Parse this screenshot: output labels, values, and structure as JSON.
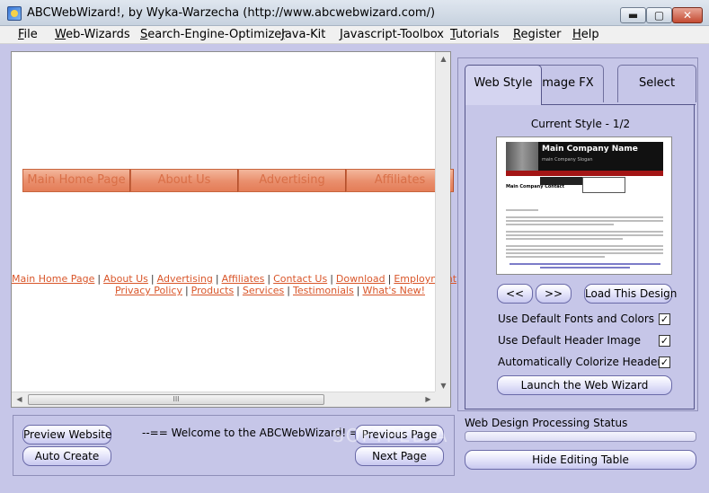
{
  "window": {
    "title": "ABCWebWizard!, by Wyka-Warzecha (http://www.abcwebwizard.com/)",
    "min_glyph": "▬",
    "max_glyph": "▢",
    "close_glyph": "✕"
  },
  "menu": [
    "File",
    "Web-Wizards",
    "Search-Engine-Optimizer",
    "Java-Kit",
    "Javascript-Toolbox",
    "Tutorials",
    "Register",
    "Help"
  ],
  "preview": {
    "nav_buttons": [
      "Main Home Page",
      "About Us",
      "Advertising",
      "Affiliates"
    ],
    "links_row1": [
      "Main Home Page",
      "About Us",
      "Advertising",
      "Affiliates",
      "Contact Us",
      "Download",
      "Employment"
    ],
    "links_row2": [
      "Privacy Policy",
      "Products",
      "Services",
      "Testimonials",
      "What's New!"
    ],
    "separator": "|",
    "scroll_up": "▲",
    "scroll_down": "▼",
    "scroll_left": "◀",
    "scroll_right": "▶",
    "hthumb_grip": "III"
  },
  "bottom_panel": {
    "preview_website": "Preview Website",
    "auto_create": "Auto Create",
    "welcome": "--== Welcome to the ABCWebWizard! ==--",
    "previous_page": "Previous Page",
    "next_page": "Next Page"
  },
  "tabs": [
    "Web Style",
    "Image FX",
    "Select Object"
  ],
  "web_style": {
    "current_style": "Current Style - 1/2",
    "thumbnail": {
      "company_name": "Main Company Name",
      "slogan": "main Company Slogan",
      "contact": "Main Company Contact"
    },
    "prev_btn": "<<",
    "next_btn": ">>",
    "load_design": "Load This Design",
    "options": [
      {
        "label": "Use Default Fonts and Colors",
        "checked": "✓"
      },
      {
        "label": "Use Default Header Image",
        "checked": "✓"
      },
      {
        "label": "Automatically Colorize Header",
        "checked": "✓"
      }
    ],
    "launch": "Launch the Web Wizard"
  },
  "status": {
    "label": "Web Design Processing Status",
    "progress": 0
  },
  "hide_editing_table": "Hide Editing Table",
  "watermark": "SOFTPEDIA"
}
